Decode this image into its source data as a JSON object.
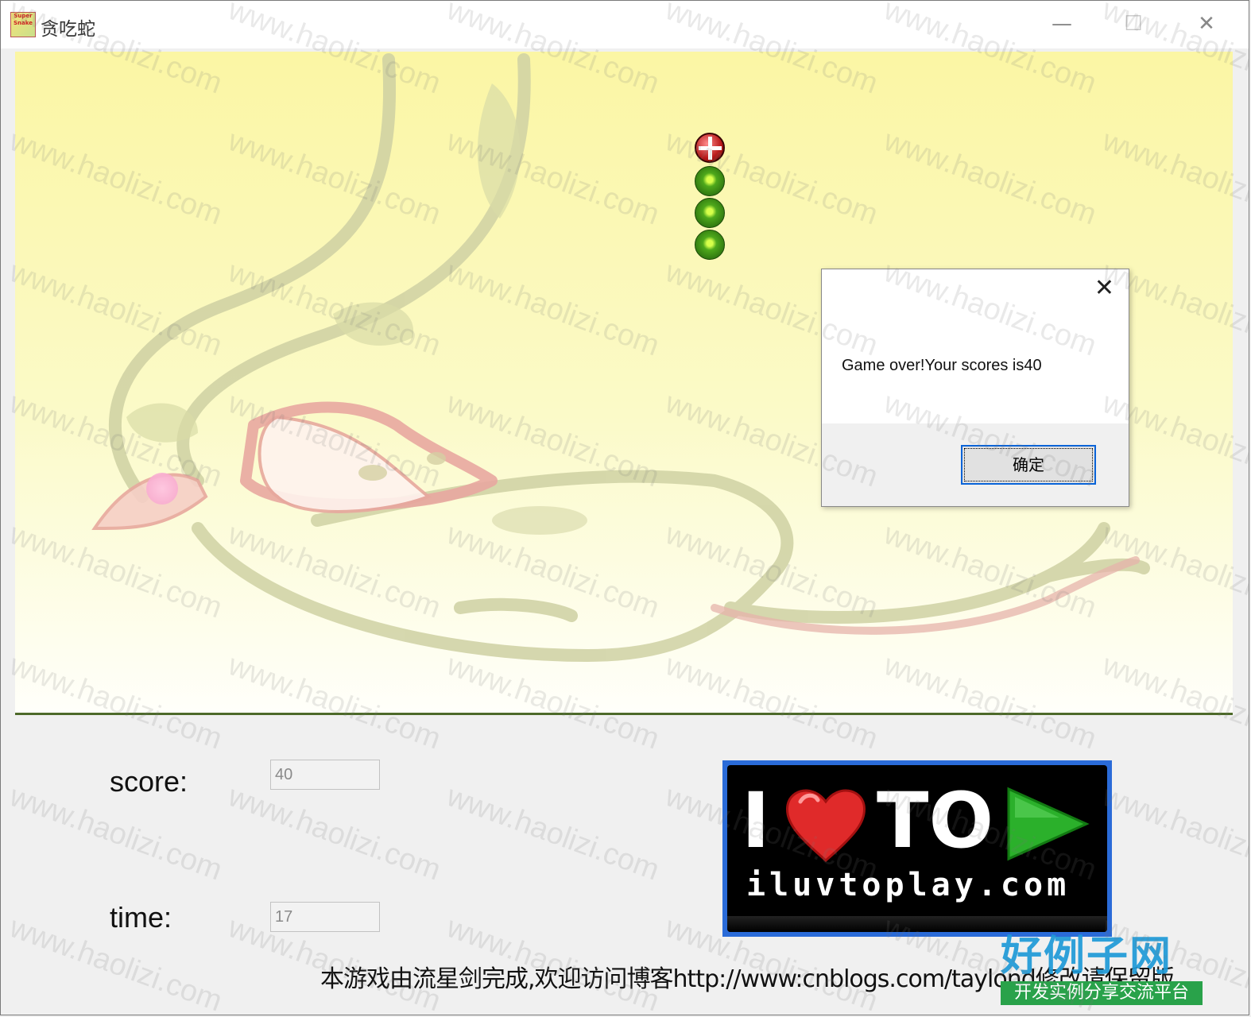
{
  "window": {
    "title": "贪吃蛇",
    "icon": "snake-game-icon",
    "icon_text": "Super Snake",
    "controls": {
      "minimize": "—",
      "maximize": "☐",
      "close": "✕"
    }
  },
  "game": {
    "background": "cartoon-snake-illustration",
    "snake": {
      "head": "red-white-cross-ball",
      "body_segments": 3
    },
    "food": "pink-dot"
  },
  "dialog": {
    "message": "Game over!Your scores is40",
    "ok_label": "确定",
    "close_icon": "✕"
  },
  "stats": {
    "score_label": "score:",
    "score_value": "40",
    "time_label": "time:",
    "time_value": "17"
  },
  "logo": {
    "letter": "I",
    "word": "TO",
    "url": "iluvtoplay.com"
  },
  "footer": {
    "credit": "本游戏由流星剑完成,欢迎访问博客http://www:cnblogs.com/taylond修改请保留版"
  },
  "brand": {
    "main": "好例子网",
    "sub": "开发实例分享交流平台"
  },
  "watermark": {
    "text": "www.haolizi.com"
  },
  "colors": {
    "accent": "#0a64d8",
    "snake_head": "#b81818",
    "snake_body": "#4ea81b",
    "game_border": "#4d6a2a"
  }
}
